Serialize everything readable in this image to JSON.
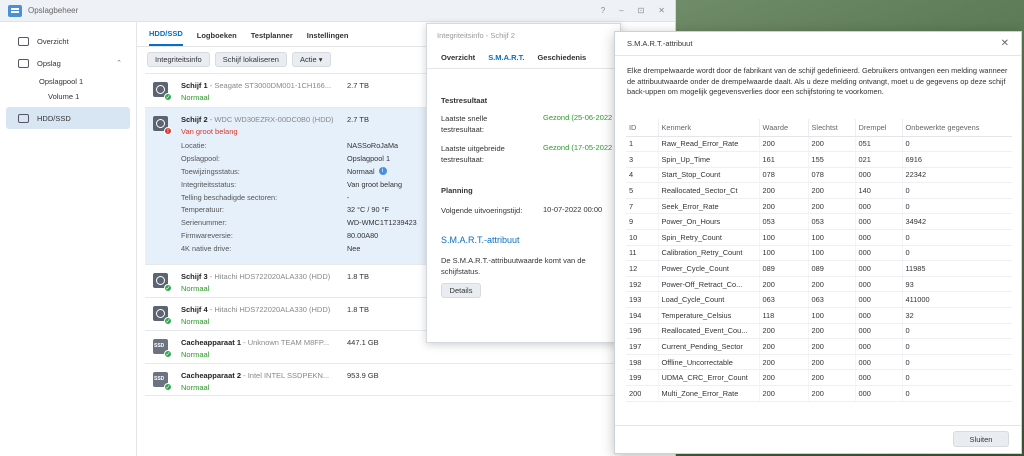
{
  "window": {
    "title": "Opslagbeheer",
    "controls": [
      "?",
      "–",
      "⊡",
      "✕"
    ]
  },
  "sidebar": {
    "items": [
      {
        "label": "Overzicht"
      },
      {
        "label": "Opslag"
      },
      {
        "label": "Opslagpool 1"
      },
      {
        "label": "Volume 1"
      },
      {
        "label": "HDD/SSD"
      }
    ]
  },
  "tabs": [
    "HDD/SSD",
    "Logboeken",
    "Testplanner",
    "Instellingen"
  ],
  "toolbar": {
    "integrity": "Integriteitsinfo",
    "locate": "Schijf lokaliseren",
    "action": "Actie ▾"
  },
  "disks": [
    {
      "name": "Schijf 1",
      "model": " - Seagate ST3000DM001-1CH166...",
      "status": "Normaal",
      "size": "2.7 TB"
    },
    {
      "name": "Schijf 2",
      "model": " - WDC WD30EZRX-00DC0B0 (HDD)",
      "status": "Van groot belang",
      "size": "2.7 TB"
    },
    {
      "name": "Schijf 3",
      "model": " - Hitachi HDS722020ALA330 (HDD)",
      "status": "Normaal",
      "size": "1.8 TB"
    },
    {
      "name": "Schijf 4",
      "model": " - Hitachi HDS722020ALA330 (HDD)",
      "status": "Normaal",
      "size": "1.8 TB"
    },
    {
      "name": "Cacheapparaat 1",
      "model": " - Unknown TEAM M8FP...",
      "status": "Normaal",
      "size": "447.1 GB"
    },
    {
      "name": "Cacheapparaat 2",
      "model": " - Intel INTEL SSDPEKN...",
      "status": "Normaal",
      "size": "953.9 GB"
    }
  ],
  "disk2_details": [
    {
      "k": "Locatie:",
      "v": "NASSoRoJaMa"
    },
    {
      "k": "Opslagpool:",
      "v": "Opslagpool 1"
    },
    {
      "k": "Toewijzingsstatus:",
      "v": "Normaal"
    },
    {
      "k": "Integriteitsstatus:",
      "v": "Van groot belang"
    },
    {
      "k": "Telling beschadigde sectoren:",
      "v": "-"
    },
    {
      "k": "Temperatuur:",
      "v": "32 °C / 90 °F"
    },
    {
      "k": "Serienummer:",
      "v": "WD-WMC1T1239423"
    },
    {
      "k": "Firmwareversie:",
      "v": "80.00A80"
    },
    {
      "k": "4K native drive:",
      "v": "Nee"
    }
  ],
  "integrity": {
    "title": "Integriteitsinfo - Schijf 2",
    "tabs": [
      "Overzicht",
      "S.M.A.R.T.",
      "Geschiedenis"
    ],
    "test_section": "Testresultaat",
    "quick_label": "Laatste snelle testresultaat:",
    "quick_value": "Gezond (25-06-2022",
    "extended_label": "Laatste uitgebreide testresultaat:",
    "extended_value": "Gezond (17-05-2022",
    "planning_section": "Planning",
    "next_label": "Volgende uitvoeringstijd:",
    "next_value": "10-07-2022 00:00",
    "smart_link": "S.M.A.R.T.-attribuut",
    "smart_desc": "De S.M.A.R.T.-attribuutwaarde komt van de schijfstatus.",
    "details_btn": "Details"
  },
  "modal": {
    "title": "S.M.A.R.T.-attribuut",
    "desc": "Elke drempelwaarde wordt door de fabrikant van de schijf gedefinieerd. Gebruikers ontvangen een melding wanneer de attribuutwaarde onder de drempelwaarde daalt. Als u deze melding ontvangt, moet u de gegevens op deze schijf back-uppen om mogelijk gegevensverlies door een schijfstoring te voorkomen.",
    "columns": [
      "ID",
      "Kenmerk",
      "Waarde",
      "Slechtst",
      "Drempel",
      "Onbewerkte gegevens"
    ],
    "rows": [
      [
        "1",
        "Raw_Read_Error_Rate",
        "200",
        "200",
        "051",
        "0"
      ],
      [
        "3",
        "Spin_Up_Time",
        "161",
        "155",
        "021",
        "6916"
      ],
      [
        "4",
        "Start_Stop_Count",
        "078",
        "078",
        "000",
        "22342"
      ],
      [
        "5",
        "Reallocated_Sector_Ct",
        "200",
        "200",
        "140",
        "0"
      ],
      [
        "7",
        "Seek_Error_Rate",
        "200",
        "200",
        "000",
        "0"
      ],
      [
        "9",
        "Power_On_Hours",
        "053",
        "053",
        "000",
        "34942"
      ],
      [
        "10",
        "Spin_Retry_Count",
        "100",
        "100",
        "000",
        "0"
      ],
      [
        "11",
        "Calibration_Retry_Count",
        "100",
        "100",
        "000",
        "0"
      ],
      [
        "12",
        "Power_Cycle_Count",
        "089",
        "089",
        "000",
        "11985"
      ],
      [
        "192",
        "Power-Off_Retract_Co...",
        "200",
        "200",
        "000",
        "93"
      ],
      [
        "193",
        "Load_Cycle_Count",
        "063",
        "063",
        "000",
        "411000"
      ],
      [
        "194",
        "Temperature_Celsius",
        "118",
        "100",
        "000",
        "32"
      ],
      [
        "196",
        "Reallocated_Event_Cou...",
        "200",
        "200",
        "000",
        "0"
      ],
      [
        "197",
        "Current_Pending_Sector",
        "200",
        "200",
        "000",
        "0"
      ],
      [
        "198",
        "Offline_Uncorrectable",
        "200",
        "200",
        "000",
        "0"
      ],
      [
        "199",
        "UDMA_CRC_Error_Count",
        "200",
        "200",
        "000",
        "0"
      ],
      [
        "200",
        "Multi_Zone_Error_Rate",
        "200",
        "200",
        "000",
        "0"
      ]
    ],
    "close_label": "Sluiten"
  }
}
